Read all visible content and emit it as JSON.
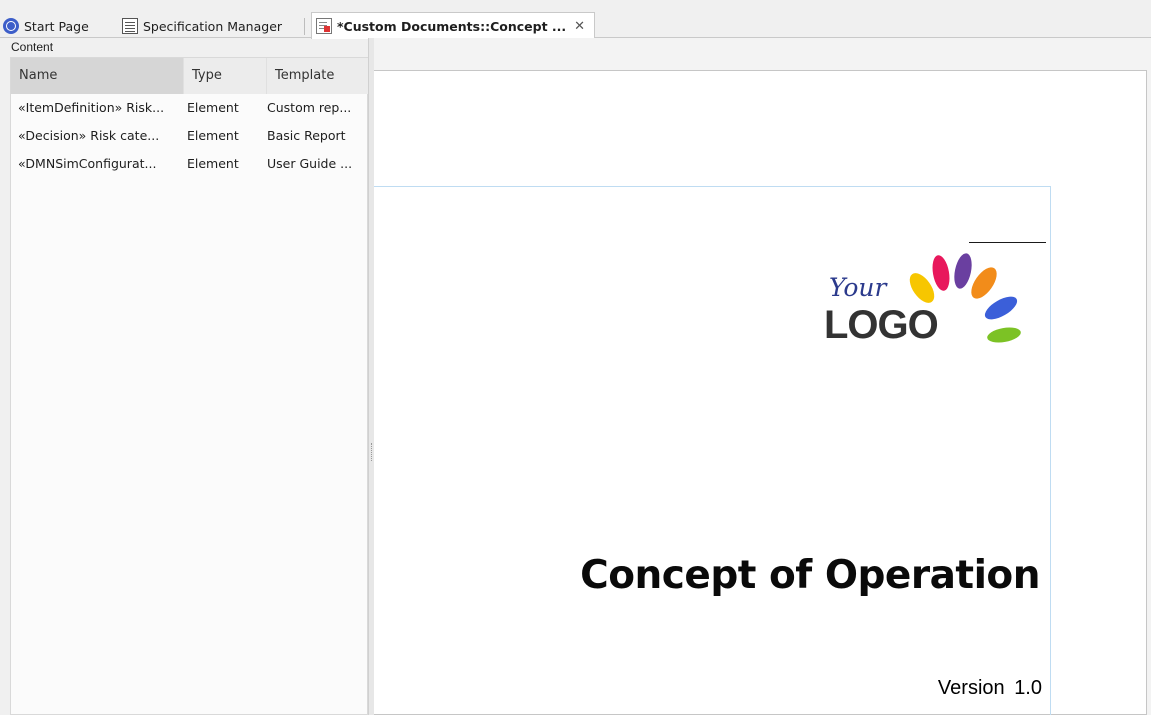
{
  "tabs": [
    {
      "label": "Start Page",
      "icon": "start-page-icon"
    },
    {
      "label": "Specification Manager",
      "icon": "specification-icon"
    },
    {
      "label": "*Custom Documents::Concept ...",
      "icon": "document-icon",
      "close": "✕"
    }
  ],
  "content_panel": {
    "label": "Content",
    "columns": [
      "Name",
      "Type",
      "Template"
    ],
    "rows": [
      {
        "name": "«ItemDefinition» Risk...",
        "type": "Element",
        "template": "Custom rep..."
      },
      {
        "name": "«Decision» Risk cate...",
        "type": "Element",
        "template": "Basic Report"
      },
      {
        "name": "«DMNSimConfigurat...",
        "type": "Element",
        "template": "User Guide ..."
      }
    ]
  },
  "document": {
    "logo_your": "Your",
    "logo_logo": "LOGO",
    "title": "Concept of Operation",
    "version": "Version 1.0",
    "logo_colors": [
      "#f7c600",
      "#e8185c",
      "#6a3fa0",
      "#f28c1a",
      "#3b5fd9",
      "#7cc225"
    ]
  }
}
